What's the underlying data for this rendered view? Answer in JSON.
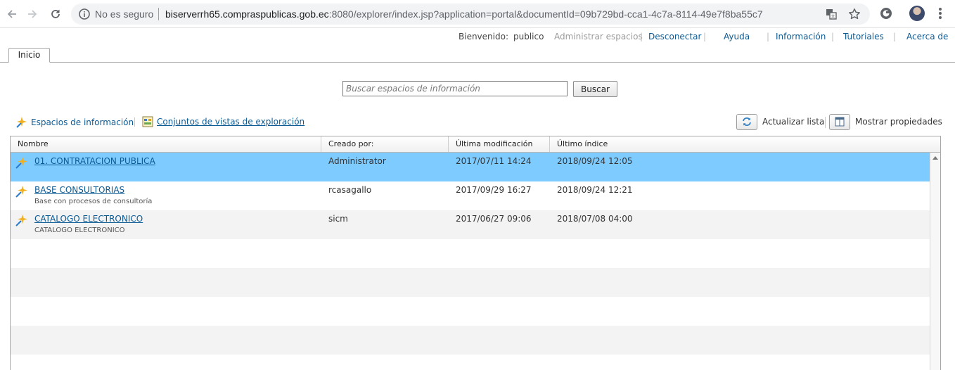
{
  "browser": {
    "security_label": "No es seguro",
    "url_host": "biserverrh65.compraspublicas.gob.ec",
    "url_rest": ":8080/explorer/index.jsp?application=portal&documentId=09b729bd-cca1-4c7a-8114-49e7f8ba55c7"
  },
  "header": {
    "welcome_label": "Bienvenido:",
    "user": "publico",
    "admin_spaces": "Administrar espacios",
    "disconnect": "Desconectar",
    "help": "Ayuda",
    "info": "Información",
    "tutorials": "Tutoriales",
    "about": "Acerca de"
  },
  "tabs": [
    {
      "label": "Inicio"
    }
  ],
  "search": {
    "placeholder": "Buscar espacios de información",
    "button": "Buscar"
  },
  "toolbar": {
    "info_spaces": "Espacios de información",
    "exploration_sets": "Conjuntos de vistas de exploración",
    "refresh": "Actualizar lista",
    "show_props": "Mostrar propiedades"
  },
  "table": {
    "columns": [
      "Nombre",
      "Creado por:",
      "Última modificación",
      "Último índice"
    ],
    "rows": [
      {
        "name": "01. CONTRATACION PUBLICA",
        "description": "",
        "created_by": "Administrator",
        "modified": "2017/07/11 14:24",
        "indexed": "2018/09/24 12:05"
      },
      {
        "name": "BASE CONSULTORIAS",
        "description": "Base con procesos de consultoría",
        "created_by": "rcasagallo",
        "modified": "2017/09/29 16:27",
        "indexed": "2018/09/24 12:21"
      },
      {
        "name": "CATALOGO ELECTRONICO",
        "description": "CATALOGO ELECTRONICO",
        "created_by": "sicm",
        "modified": "2017/06/27 09:06",
        "indexed": "2018/07/08 04:00"
      }
    ]
  },
  "colors": {
    "link": "#0b5a94",
    "selected_row": "#7ecbff"
  }
}
